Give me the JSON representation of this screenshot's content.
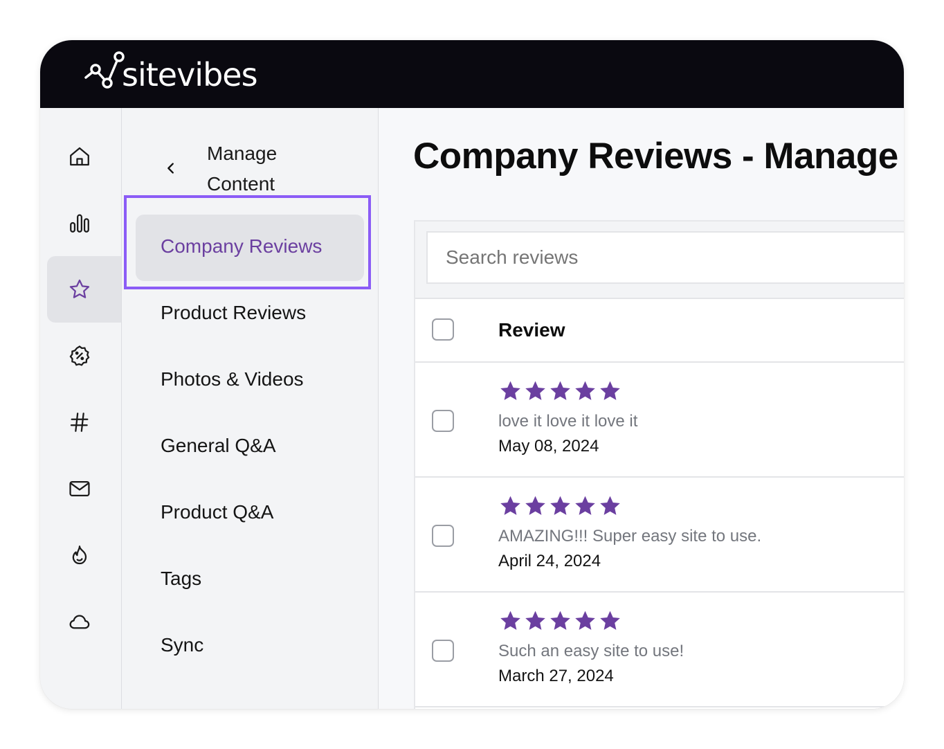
{
  "app": {
    "brand": "sitevibes"
  },
  "rail": {
    "items": [
      {
        "icon": "home-icon",
        "active": false
      },
      {
        "icon": "bar-chart-icon",
        "active": false
      },
      {
        "icon": "star-icon",
        "active": true
      },
      {
        "icon": "discount-badge-icon",
        "active": false
      },
      {
        "icon": "hashtag-icon",
        "active": false
      },
      {
        "icon": "mail-icon",
        "active": false
      },
      {
        "icon": "flame-icon",
        "active": false
      },
      {
        "icon": "cloud-icon",
        "active": false
      }
    ]
  },
  "subnav": {
    "title": "Manage Content",
    "back_icon": "chevron-left-icon",
    "active_item": "Company Reviews",
    "items": [
      {
        "label": "Company Reviews"
      },
      {
        "label": "Product Reviews"
      },
      {
        "label": "Photos & Videos"
      },
      {
        "label": "General Q&A"
      },
      {
        "label": "Product Q&A"
      },
      {
        "label": "Tags"
      },
      {
        "label": "Sync"
      }
    ]
  },
  "main": {
    "title": "Company Reviews - Manage C",
    "search": {
      "placeholder": "Search reviews",
      "value": ""
    },
    "table": {
      "column_header": "Review",
      "rows": [
        {
          "rating": 5,
          "text": "love it love it love it",
          "date": "May 08, 2024"
        },
        {
          "rating": 5,
          "text": "AMAZING!!! Super easy site to use.",
          "date": "April 24, 2024"
        },
        {
          "rating": 5,
          "text": "Such an easy site to use!",
          "date": "March 27, 2024"
        }
      ]
    }
  },
  "colors": {
    "topbar": "#0a0910",
    "accent": "#6b3fa0",
    "star": "#6b3fa0",
    "focus_outline": "#8b5cf6"
  }
}
